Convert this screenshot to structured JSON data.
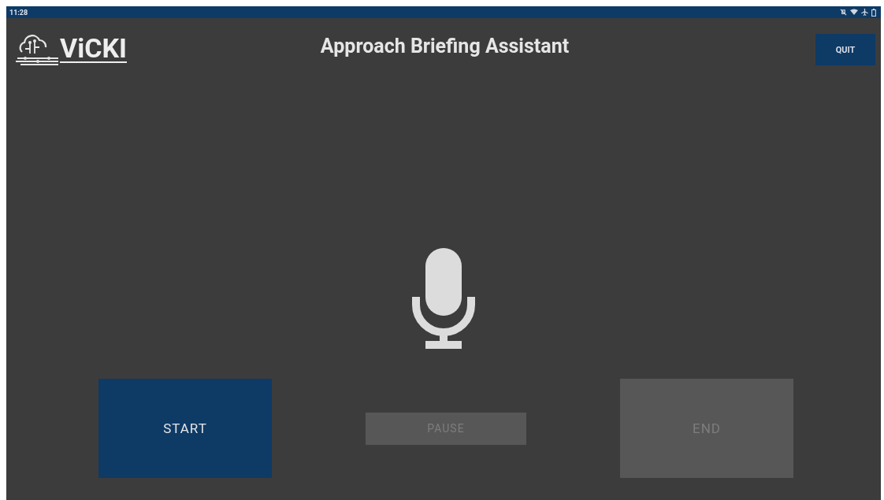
{
  "status_bar": {
    "time": "11:28"
  },
  "header": {
    "logo": "ViCKI",
    "title": "Approach Briefing Assistant",
    "quit_button": "QUIT"
  },
  "buttons": [
    {
      "kind": "large",
      "label": "START",
      "disabled": false
    },
    {
      "kind": "small",
      "label": "PAUSE",
      "disabled": true
    },
    {
      "kind": "large",
      "label": "END",
      "disabled": true
    }
  ]
}
